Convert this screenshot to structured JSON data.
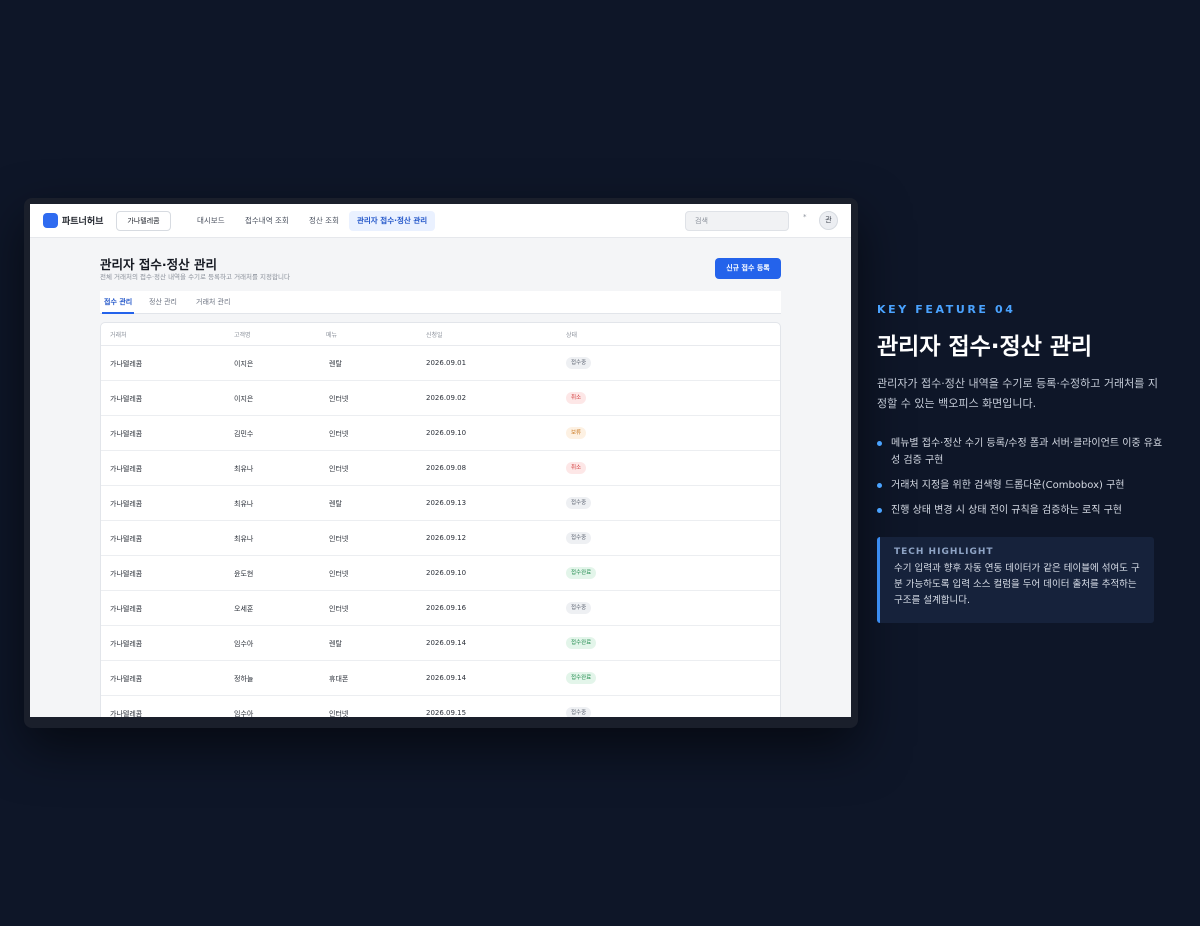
{
  "app": {
    "logo_text": "파트너허브",
    "company": "가나텔레콤",
    "nav": [
      {
        "label": "대시보드"
      },
      {
        "label": "접수내역 조회"
      },
      {
        "label": "정산 조회"
      },
      {
        "label": "관리자 접수·정산 관리",
        "active": true
      }
    ],
    "search_placeholder": "검색",
    "avatar_initial": "관",
    "colors": {
      "accent": "#2463eb",
      "brand": "#2f6bf0"
    }
  },
  "page": {
    "title": "관리자 접수·정산 관리",
    "subtitle": "전체 거래처의 접수·정산 내역을 수기로 등록하고 거래처를 지정합니다",
    "primary_button": "신규 접수 등록",
    "tabs": [
      "접수 관리",
      "정산 관리",
      "거래처 관리"
    ],
    "active_tab": 0
  },
  "table": {
    "columns": [
      "거래처",
      "고객명",
      "메뉴",
      "신청일",
      "상태"
    ],
    "rows": [
      {
        "partner": "가나텔레콤",
        "customer": "이지은",
        "menu": "렌탈",
        "date": "2026.09.01",
        "status": "접수중",
        "tone": "gray"
      },
      {
        "partner": "가나텔레콤",
        "customer": "이지은",
        "menu": "인터넷",
        "date": "2026.09.02",
        "status": "취소",
        "tone": "red"
      },
      {
        "partner": "가나텔레콤",
        "customer": "김민수",
        "menu": "인터넷",
        "date": "2026.09.10",
        "status": "보류",
        "tone": "orange"
      },
      {
        "partner": "가나텔레콤",
        "customer": "최유나",
        "menu": "인터넷",
        "date": "2026.09.08",
        "status": "취소",
        "tone": "red"
      },
      {
        "partner": "가나텔레콤",
        "customer": "최유나",
        "menu": "렌탈",
        "date": "2026.09.13",
        "status": "접수중",
        "tone": "gray"
      },
      {
        "partner": "가나텔레콤",
        "customer": "최유나",
        "menu": "인터넷",
        "date": "2026.09.12",
        "status": "접수중",
        "tone": "gray"
      },
      {
        "partner": "가나텔레콤",
        "customer": "윤도현",
        "menu": "인터넷",
        "date": "2026.09.10",
        "status": "접수완료",
        "tone": "green"
      },
      {
        "partner": "가나텔레콤",
        "customer": "오세훈",
        "menu": "인터넷",
        "date": "2026.09.16",
        "status": "접수중",
        "tone": "gray"
      },
      {
        "partner": "가나텔레콤",
        "customer": "임수아",
        "menu": "렌탈",
        "date": "2026.09.14",
        "status": "접수완료",
        "tone": "green"
      },
      {
        "partner": "가나텔레콤",
        "customer": "정하늘",
        "menu": "휴대폰",
        "date": "2026.09.14",
        "status": "접수완료",
        "tone": "green"
      },
      {
        "partner": "가나텔레콤",
        "customer": "임수아",
        "menu": "인터넷",
        "date": "2026.09.15",
        "status": "접수중",
        "tone": "gray"
      }
    ]
  },
  "feature": {
    "kicker": "KEY FEATURE 04",
    "title": "관리자 접수·정산 관리",
    "description": "관리자가 접수·정산 내역을 수기로 등록·수정하고 거래처를 지정할 수 있는 백오피스 화면입니다.",
    "bullets": [
      "메뉴별 접수·정산 수기 등록/수정 폼과 서버·클라이언트 이중 유효성 검증 구현",
      "거래처 지정을 위한 검색형 드롭다운(Combobox) 구현",
      "진행 상태 변경 시 상태 전이 규칙을 검증하는 로직 구현"
    ],
    "highlight_label": "TECH HIGHLIGHT",
    "highlight_text": "수기 입력과 향후 자동 연동 데이터가 같은 테이블에 섞여도 구분 가능하도록 입력 소스 컬럼을 두어 데이터 출처를 추적하는 구조를 설계합니다."
  }
}
